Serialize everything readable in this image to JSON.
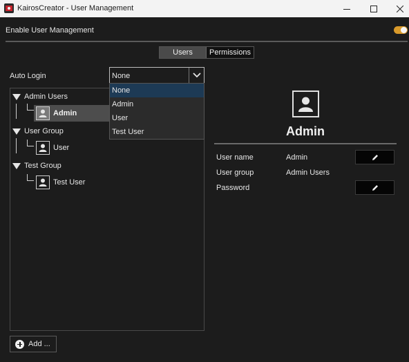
{
  "window": {
    "title": "KairosCreator - User Management"
  },
  "settings": {
    "enable_label": "Enable User Management",
    "enabled": true
  },
  "tabs": [
    {
      "label": "Users",
      "active": true
    },
    {
      "label": "Permissions",
      "active": false
    }
  ],
  "auto_login": {
    "label": "Auto Login",
    "value": "None",
    "options": [
      "None",
      "Admin",
      "User",
      "Test User"
    ],
    "highlighted": "None"
  },
  "tree": {
    "groups": [
      {
        "label": "Admin Users",
        "users": [
          {
            "name": "Admin",
            "selected": true
          }
        ]
      },
      {
        "label": "User Group",
        "users": [
          {
            "name": "User",
            "selected": false
          }
        ]
      },
      {
        "label": "Test Group",
        "users": [
          {
            "name": "Test User",
            "selected": false
          }
        ]
      }
    ]
  },
  "add_button": {
    "label": "Add ..."
  },
  "detail": {
    "name": "Admin",
    "fields": [
      {
        "label": "User name",
        "value": "Admin",
        "editable": true
      },
      {
        "label": "User group",
        "value": "Admin Users",
        "editable": false
      },
      {
        "label": "Password",
        "value": "",
        "editable": true
      }
    ]
  },
  "colors": {
    "accent_toggle": "#d99a2b",
    "selection": "#1d3a55",
    "background": "#1c1c1c"
  }
}
